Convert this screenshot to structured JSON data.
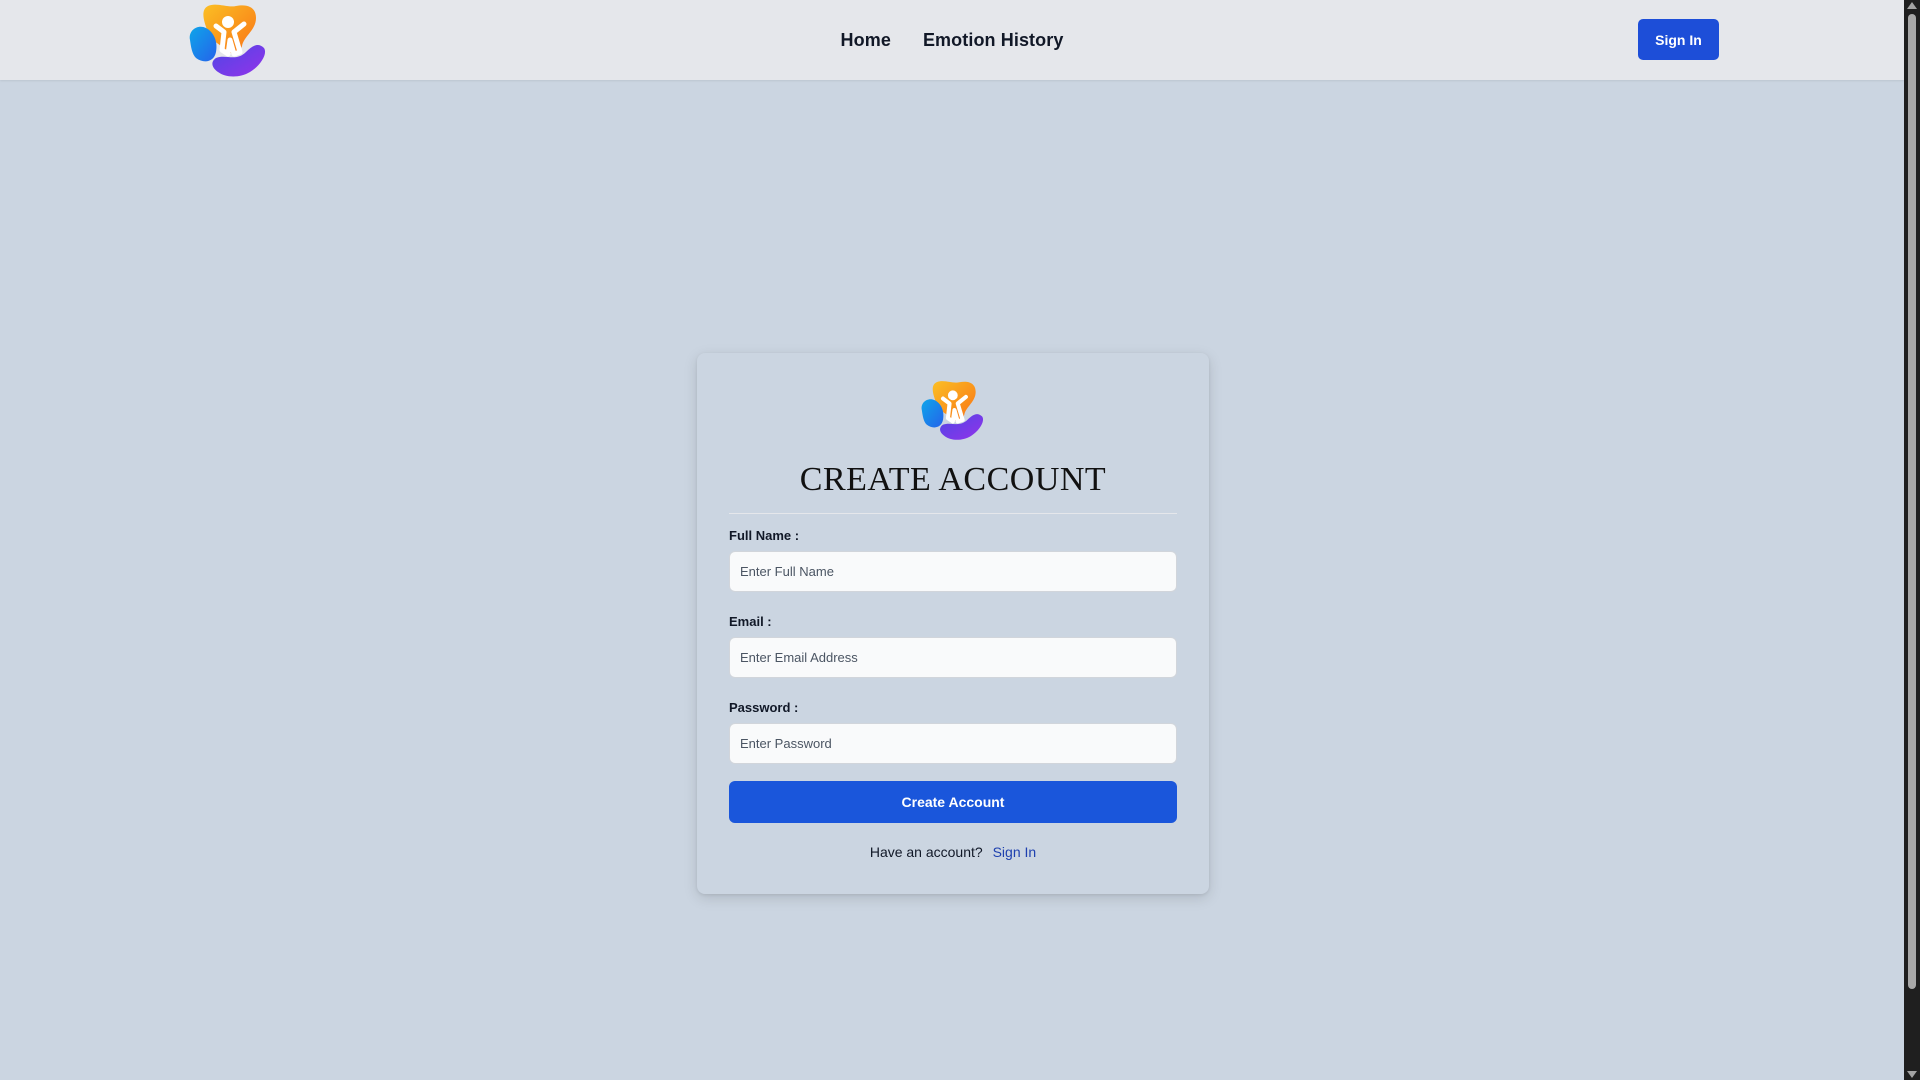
{
  "navbar": {
    "logo_icon": "kids-emotion-logo-icon",
    "links": [
      {
        "label": "Home"
      },
      {
        "label": "Emotion History"
      }
    ],
    "signin_label": "Sign In"
  },
  "form": {
    "logo_icon": "kids-emotion-logo-icon",
    "title": "CREATE ACCOUNT",
    "fields": {
      "full_name": {
        "label": "Full Name :",
        "placeholder": "Enter Full Name",
        "value": ""
      },
      "email": {
        "label": "Email :",
        "placeholder": "Enter Email Address",
        "value": ""
      },
      "password": {
        "label": "Password :",
        "placeholder": "Enter Password",
        "value": ""
      }
    },
    "submit_label": "Create Account",
    "footer_text": "Have an account?",
    "footer_link": "Sign In"
  },
  "colors": {
    "page_background": "#cbd5e1",
    "navbar_background": "#e5e7eb",
    "primary_button": "#1a56db",
    "link": "#1e40af"
  }
}
